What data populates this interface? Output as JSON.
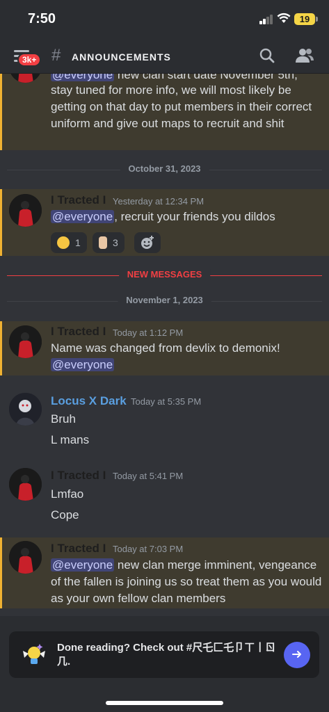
{
  "status_bar": {
    "time": "7:50",
    "battery": "19"
  },
  "header": {
    "badge": "3k+",
    "hash": "#",
    "channel": "ANNOUNCEMENTS"
  },
  "messages": {
    "m0": {
      "mention": "@everyone",
      "text_a": " new clan start date November 5th,",
      "text_rest": "stay tuned for more info, we will most likely be getting on that day to put members in their correct uniform and give out maps to recruit and shit"
    },
    "divider1": "October 31, 2023",
    "m1": {
      "user": "I Tracted I",
      "time": "Yesterday at 12:34 PM",
      "mention": "@everyone",
      "text": ", recruit your friends you dildos",
      "reactions": [
        {
          "emoji": "nerd-face",
          "count": "1"
        },
        {
          "emoji": "pointing-up",
          "count": "3"
        }
      ]
    },
    "new_messages": "NEW MESSAGES",
    "divider2": "November 1, 2023",
    "m2": {
      "user": "I Tracted I",
      "time": "Today at 1:12 PM",
      "text": "Name was changed from devlix to demonix!",
      "mention": "@everyone"
    },
    "m3": {
      "user": "Locus X Dark",
      "time": "Today at 5:35 PM",
      "line1": "Bruh",
      "line2": "L mans"
    },
    "m4": {
      "user": "I Tracted I",
      "time": "Today at 5:41 PM",
      "line1": "Lmfao",
      "line2": "Cope"
    },
    "m5": {
      "user": "I Tracted I",
      "time": "Today at 7:03 PM",
      "mention": "@everyone",
      "text": " new clan merge imminent, vengeance of the fallen is joining us so treat them as you would as your own fellow clan members"
    }
  },
  "prompt": {
    "text": "Done reading? Check out #尺乇匚乇卩ㄒ丨ㄖ 几."
  },
  "colors": {
    "accent": "#5865f2",
    "mention_highlight": "#3f3b2f",
    "new_messages": "#f23f43",
    "username_blue": "#5a9fe0"
  }
}
